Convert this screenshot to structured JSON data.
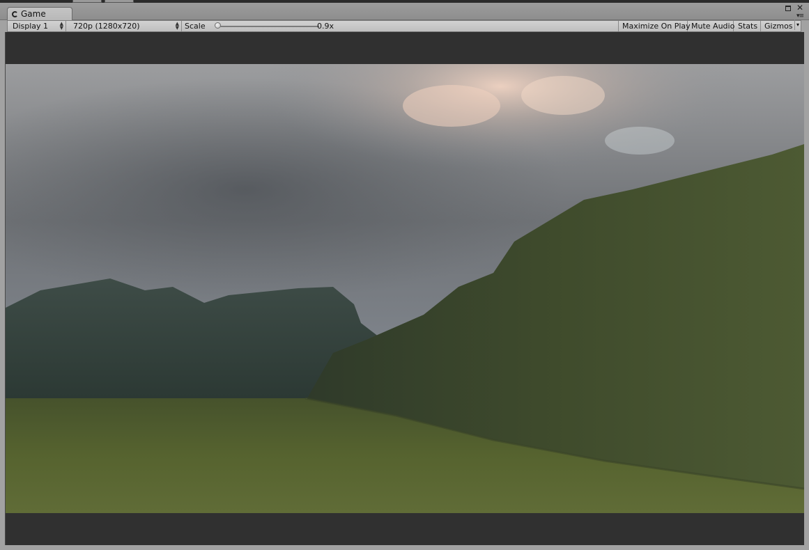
{
  "window": {
    "tab_title": "Game"
  },
  "toolbar": {
    "display_label": "Display 1",
    "resolution_label": "720p (1280x720)",
    "scale_label": "Scale",
    "scale_value_text": "0.9x",
    "scale_value": 0.9,
    "maximize_on_play_label": "Maximize On Play",
    "mute_audio_label": "Mute Audio",
    "stats_label": "Stats",
    "gizmos_label": "Gizmos"
  },
  "icons": {
    "tab": "unity-logo-icon",
    "dropdown": "dropdown-arrows-icon",
    "close": "close-icon",
    "maximize": "maximize-icon",
    "menu": "menu-icon"
  },
  "colors": {
    "viewport_background": "#303030",
    "toolbar": "#c9c9c9",
    "sky": "#8a8d91",
    "terrain": "#4e5a2e",
    "distant_mountains": "#323f3a"
  }
}
